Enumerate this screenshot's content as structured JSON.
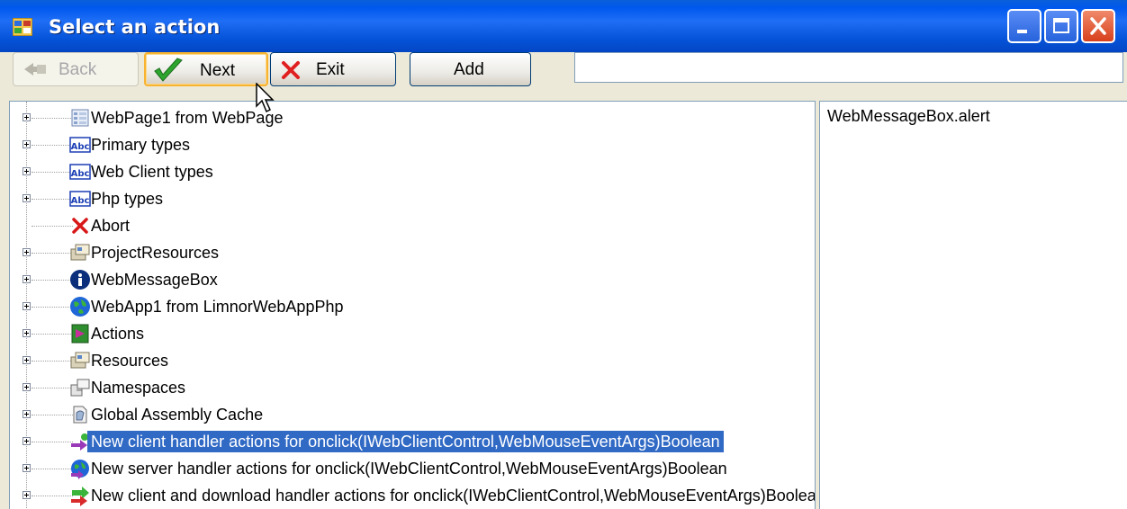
{
  "window": {
    "title": "Select an action",
    "controls": [
      "minimize-icon",
      "maximize-icon",
      "close-icon"
    ]
  },
  "toolbar": {
    "back_label": "Back",
    "next_label": "Next",
    "exit_label": "Exit",
    "add_label": "Add",
    "command_input_value": ""
  },
  "tree": {
    "items": [
      {
        "label": "WebPage1 from WebPage",
        "icon": "webpage-icon",
        "expandable": true
      },
      {
        "label": "Primary types",
        "icon": "abc-type-icon",
        "expandable": true
      },
      {
        "label": "Web Client types",
        "icon": "abc-type-icon",
        "expandable": true
      },
      {
        "label": "Php types",
        "icon": "abc-type-icon",
        "expandable": true
      },
      {
        "label": "Abort",
        "icon": "red-x-icon",
        "expandable": false
      },
      {
        "label": "ProjectResources",
        "icon": "resources-icon",
        "expandable": true
      },
      {
        "label": "WebMessageBox",
        "icon": "info-icon",
        "expandable": true
      },
      {
        "label": "WebApp1 from LimnorWebAppPhp",
        "icon": "globe-icon",
        "expandable": true
      },
      {
        "label": "Actions",
        "icon": "actions-icon",
        "expandable": true
      },
      {
        "label": "Resources",
        "icon": "resources-icon",
        "expandable": true
      },
      {
        "label": "Namespaces",
        "icon": "namespaces-icon",
        "expandable": true
      },
      {
        "label": "Global Assembly Cache",
        "icon": "assembly-cache-icon",
        "expandable": true
      },
      {
        "label": "New client handler actions for onclick(IWebClientControl,WebMouseEventArgs)Boolean",
        "icon": "client-handler-icon",
        "expandable": true,
        "selected": true
      },
      {
        "label": "New server handler actions for onclick(IWebClientControl,WebMouseEventArgs)Boolean",
        "icon": "server-handler-icon",
        "expandable": true
      },
      {
        "label": "New client and download handler actions for onclick(IWebClientControl,WebMouseEventArgs)Boolean",
        "icon": "download-handler-icon",
        "expandable": true
      }
    ]
  },
  "list": {
    "items": [
      "WebMessageBox.alert"
    ]
  },
  "colors": {
    "titlebar": "#0058ee",
    "selection": "#316ac5",
    "face": "#ece9d8"
  }
}
